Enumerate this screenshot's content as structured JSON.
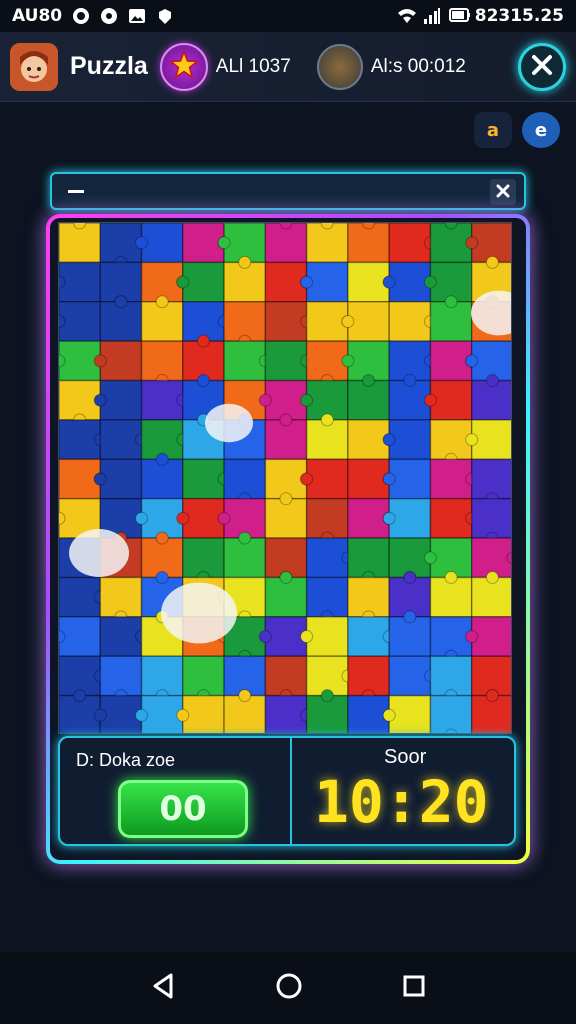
{
  "status_bar": {
    "left_text": "AU80",
    "time": "82315.25"
  },
  "header": {
    "title": "Puzzla",
    "level_text": "ALl 1037",
    "coins_text": "Al:s 00:012"
  },
  "mini_buttons": [
    "a",
    "e"
  ],
  "info": {
    "label": "D: Doka zoe",
    "counter": "00",
    "score_label": "Soor",
    "timer": "10:20"
  },
  "colors": {
    "accent_cyan": "#27c3e3",
    "neon_pink": "#ff3df2",
    "timer_yellow": "#ffe321",
    "green_button": "#1fbf32"
  },
  "icons": [
    "camera-icon",
    "settings-icon",
    "image-icon",
    "lock-icon",
    "wifi-icon",
    "signal-icon",
    "battery-icon",
    "star-icon",
    "close-icon",
    "minimize-icon",
    "back-icon",
    "home-icon",
    "recents-icon"
  ]
}
